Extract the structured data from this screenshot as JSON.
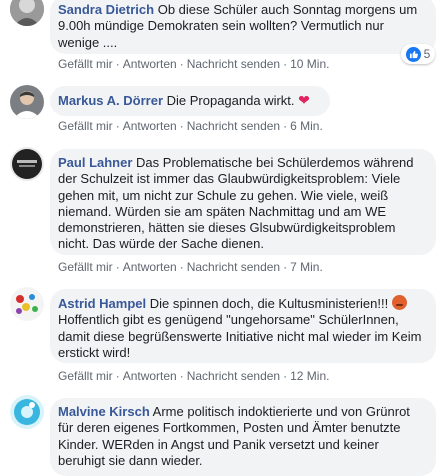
{
  "action_labels": {
    "like": "Gefällt mir",
    "reply": "Antworten",
    "message": "Nachricht senden",
    "dot": "·"
  },
  "reactions": {
    "count": "5",
    "icon": "like-icon"
  },
  "comments": [
    {
      "author": "Sandra Dietrich",
      "text": "Ob diese Schüler auch Sonntag morgens um 9.00h mündige Demokraten sein wollten? Vermutlich nur wenige ....",
      "time": "10 Min."
    },
    {
      "author": "Markus A. Dörrer",
      "text": "Die Propaganda wirkt.",
      "emoji": "❤",
      "time": "6 Min."
    },
    {
      "author": "Paul Lahner",
      "text": "Das Problematische bei Schülerdemos während der Schulzeit ist immer das Glaubwürdigkeitsproblem: Viele gehen mit, um nicht zur Schule zu gehen. Wie viele, weiß niemand. Würden sie am späten Nachmittag und am WE demonstrieren, hätten sie dieses Glsubwürdigkeitsproblem nicht. Das würde der Sache dienen.",
      "time": "7 Min."
    },
    {
      "author": "Astrid Hampel",
      "text": "Die spinnen doch, die Kultusministerien!!!",
      "text2": "Hoffentlich gibt es genügend \"ungehorsame\" SchülerInnen, damit diese begrüßenswerte Initiative nicht mal wieder im Keim erstickt wird!",
      "time": "12 Min."
    },
    {
      "author": "Malvine Kirsch",
      "text": "Arme politisch indoktierierte und von Grünrot für deren eigenes Fortkommen, Posten und Ämter benutzte Kinder. WERden in Angst und Panik versetzt und keiner beruhigt sie dann wieder."
    }
  ]
}
